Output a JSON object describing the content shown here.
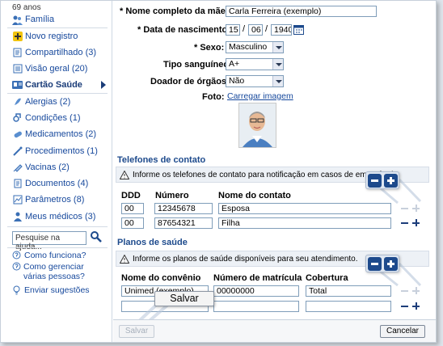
{
  "sidebar": {
    "age": "69 anos",
    "items": [
      {
        "label": "Família",
        "icon": "family-icon"
      },
      {
        "label": "Novo registro",
        "icon": "add-icon"
      },
      {
        "label": "Compartilhado (3)",
        "icon": "share-icon"
      },
      {
        "label": "Visão geral (20)",
        "icon": "overview-icon"
      },
      {
        "label": "Cartão Saúde",
        "icon": "health-card-icon"
      },
      {
        "label": "Alergias (2)",
        "icon": "allergy-icon"
      },
      {
        "label": "Condições (1)",
        "icon": "conditions-icon"
      },
      {
        "label": "Medicamentos (2)",
        "icon": "pill-icon"
      },
      {
        "label": "Procedimentos (1)",
        "icon": "procedure-icon"
      },
      {
        "label": "Vacinas (2)",
        "icon": "vaccine-icon"
      },
      {
        "label": "Documentos (4)",
        "icon": "document-icon"
      },
      {
        "label": "Parâmetros (8)",
        "icon": "parameters-icon"
      },
      {
        "label": "Meus médicos (3)",
        "icon": "doctor-icon"
      }
    ],
    "search_placeholder": "Pesquise na ajuda...",
    "help_links": [
      "Como funciona?",
      "Como gerenciar várias pessoas?",
      "Enviar sugestões"
    ]
  },
  "form": {
    "mother_label": "* Nome completo da mãe:",
    "mother_value": "Carla Ferreira (exemplo)",
    "birth_label": "* Data de nascimento:",
    "birth_day": "15",
    "birth_month": "06",
    "birth_year": "1940",
    "sex_label": "* Sexo:",
    "sex_value": "Masculino",
    "blood_label": "Tipo sanguíneo:",
    "blood_value": "A+",
    "donor_label": "Doador de órgãos?",
    "donor_value": "Não",
    "photo_label": "Foto:",
    "photo_link": "Carregar imagem"
  },
  "contacts": {
    "title": "Telefones de contato",
    "info": "Informe os telefones de contato para notificação em casos de emergência.",
    "headers": [
      "DDD",
      "Número",
      "Nome do contato"
    ],
    "rows": [
      {
        "ddd": "00",
        "number": "12345678",
        "name": "Esposa"
      },
      {
        "ddd": "00",
        "number": "87654321",
        "name": "Filha"
      }
    ]
  },
  "plans": {
    "title": "Planos de saúde",
    "info": "Informe os planos de saúde disponíveis para seu atendimento.",
    "headers": [
      "Nome do convênio",
      "Número de matrícula",
      "Cobertura"
    ],
    "rows": [
      {
        "plan": "Unimed (exemplo)",
        "id": "00000000",
        "coverage": "Total"
      },
      {
        "plan": "",
        "id": "",
        "coverage": ""
      }
    ]
  },
  "buttons": {
    "save": "Salvar",
    "cancel": "Cancelar",
    "save_callout": "Salvar"
  },
  "colors": {
    "link": "#16489c",
    "section_title": "#1d4a8c",
    "zoom_button": "#1d4a8c"
  }
}
